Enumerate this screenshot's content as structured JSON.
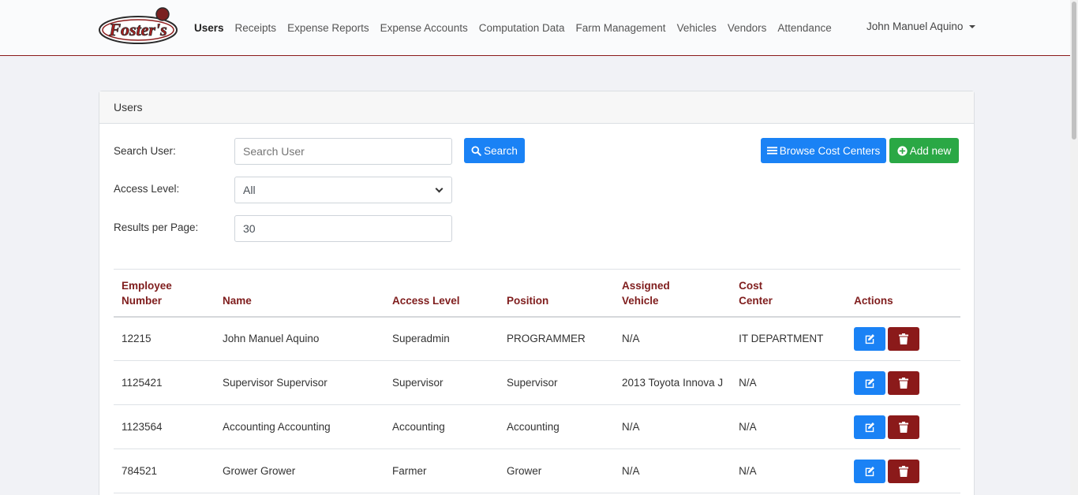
{
  "nav": {
    "brand": "Foster's",
    "links": [
      "Users",
      "Receipts",
      "Expense Reports",
      "Expense Accounts",
      "Computation Data",
      "Farm Management",
      "Vehicles",
      "Vendors",
      "Attendance"
    ],
    "active": "Users",
    "user": "John Manuel Aquino"
  },
  "card": {
    "title": "Users",
    "search_label": "Search User:",
    "search_placeholder": "Search User",
    "search_button": "Search",
    "access_label": "Access Level:",
    "access_value": "All",
    "rpp_label": "Results per Page:",
    "rpp_value": "30",
    "browse_button": "Browse Cost Centers",
    "add_button": "Add new"
  },
  "table": {
    "headers": [
      [
        "Employee",
        "Number"
      ],
      [
        "Name"
      ],
      [
        "Access Level"
      ],
      [
        "Position"
      ],
      [
        "Assigned",
        "Vehicle"
      ],
      [
        "Cost",
        "Center"
      ],
      [
        "Actions"
      ]
    ],
    "rows": [
      [
        "12215",
        "John Manuel Aquino",
        "Superadmin",
        "PROGRAMMER",
        "N/A",
        "IT DEPARTMENT"
      ],
      [
        "1125421",
        "Supervisor Supervisor",
        "Supervisor",
        "Supervisor",
        "2013 Toyota Innova J",
        "N/A"
      ],
      [
        "1123564",
        "Accounting Accounting",
        "Accounting",
        "Accounting",
        "N/A",
        "N/A"
      ],
      [
        "784521",
        "Grower Grower",
        "Farmer",
        "Grower",
        "N/A",
        "N/A"
      ]
    ]
  },
  "colors": {
    "brand_red": "#8b1a1a",
    "primary": "#1a82f5",
    "success": "#2aa845"
  },
  "icons": {
    "search": "search-icon",
    "browse": "list-icon",
    "add": "plus-circle-icon",
    "edit": "edit-icon",
    "delete": "trash-icon"
  }
}
